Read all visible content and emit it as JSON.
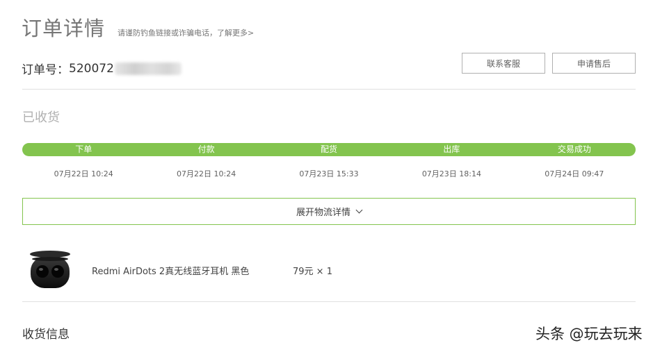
{
  "header": {
    "title": "订单详情",
    "notice": "请谨防钓鱼链接或诈骗电话，",
    "notice_link": "了解更多>"
  },
  "order": {
    "label": "订单号：",
    "number_visible": "520072"
  },
  "buttons": {
    "contact_service": "联系客服",
    "after_sale": "申请售后"
  },
  "status": "已收货",
  "progress": {
    "color": "#83c44e",
    "steps": [
      {
        "label": "下单",
        "time": "07月22日 10:24"
      },
      {
        "label": "付款",
        "time": "07月22日 10:24"
      },
      {
        "label": "配货",
        "time": "07月23日 15:33"
      },
      {
        "label": "出库",
        "time": "07月23日 18:14"
      },
      {
        "label": "交易成功",
        "time": "07月24日 09:47"
      }
    ]
  },
  "logistics": {
    "expand_label": "展开物流详情"
  },
  "product": {
    "name": "Redmi AirDots 2真无线蓝牙耳机 黑色",
    "price": "79元 × 1"
  },
  "shipping": {
    "title": "收货信息"
  },
  "watermark": "头条 @玩去玩来"
}
